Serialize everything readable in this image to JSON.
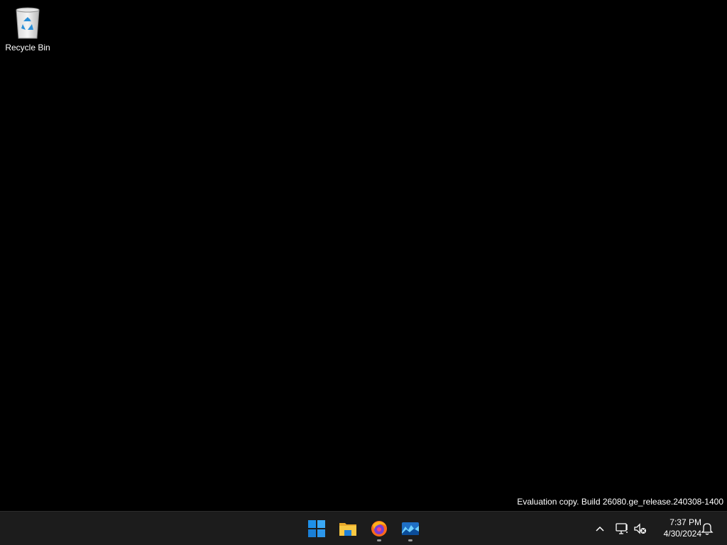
{
  "desktop": {
    "icons": [
      {
        "label": "Recycle Bin",
        "icon": "recycle-bin-icon"
      }
    ],
    "watermark": "Evaluation copy. Build 26080.ge_release.240308-1400"
  },
  "taskbar": {
    "apps": [
      {
        "name": "Start",
        "icon": "windows-start-icon",
        "running": false
      },
      {
        "name": "File Explorer",
        "icon": "file-explorer-icon",
        "running": false
      },
      {
        "name": "Firefox",
        "icon": "firefox-icon",
        "running": true
      },
      {
        "name": "Photos",
        "icon": "photos-app-icon",
        "running": true
      }
    ],
    "tray": {
      "overflow_icon": "chevron-up-icon",
      "network_icon": "network-icon",
      "volume_icon": "volume-muted-icon",
      "notifications_icon": "bell-icon"
    },
    "clock": {
      "time": "7:37 PM",
      "date": "4/30/2024"
    }
  },
  "colors": {
    "desktop_bg": "#000000",
    "taskbar_bg": "#1c1c1c",
    "start_blue": "#1e90e8"
  }
}
